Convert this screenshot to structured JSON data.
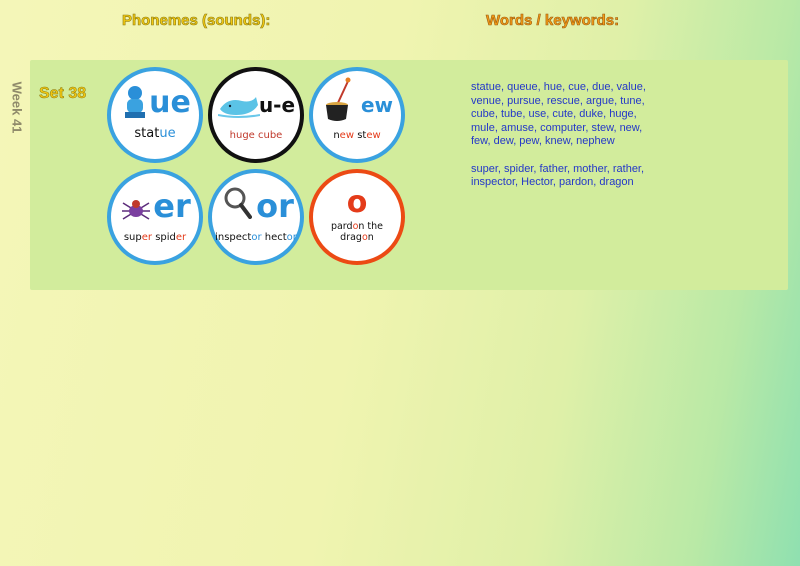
{
  "headers": {
    "phonemes": "Phonemes (sounds):",
    "words": "Words / keywords:"
  },
  "week_label": "Week 41",
  "set_label": "Set 38",
  "phonemes": [
    {
      "grapheme": "ue",
      "caption_a": "stat",
      "caption_b": "ue",
      "caption_c": "",
      "picture": "statue-icon",
      "border_color": "#3aa2e0"
    },
    {
      "grapheme": "u-e",
      "caption_a": "huge cube",
      "caption_b": "",
      "caption_c": "",
      "picture": "whale-icon",
      "border_color": "#111111"
    },
    {
      "grapheme": "ew",
      "caption_a": "n",
      "caption_b": "ew",
      "caption_c": " st",
      "caption_d": "ew",
      "picture": "stew-pot-icon",
      "border_color": "#3aa2e0"
    },
    {
      "grapheme": "er",
      "caption_a": "sup",
      "caption_b": "er",
      "caption_c": " spid",
      "caption_d": "er",
      "picture": "spider-icon",
      "border_color": "#3aa2e0"
    },
    {
      "grapheme": "or",
      "caption_a": "inspect",
      "caption_b": "or",
      "caption_c": " hect",
      "caption_d": "or",
      "picture": "magnifying-glass-icon",
      "border_color": "#3aa2e0"
    },
    {
      "grapheme": "o",
      "caption_a": "pard",
      "caption_b": "o",
      "caption_c": "n the drag",
      "caption_d": "o",
      "caption_e": "n",
      "picture": "none",
      "border_color": "#ec4a14"
    }
  ],
  "keywords": {
    "group1": "statue, queue, hue, cue, due, value, venue, pursue, rescue, argue, tune, cube, tube, use, cute, duke, huge, mule, amuse, computer, stew, new, few, dew, pew, knew, nephew",
    "group2": "super, spider, father, mother, rather, inspector, Hector, pardon, dragon"
  }
}
